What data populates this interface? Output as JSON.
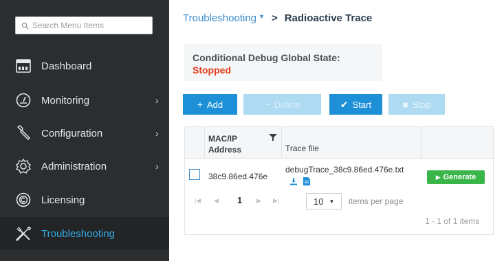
{
  "sidebar": {
    "search_placeholder": "Search Menu Items",
    "items": [
      {
        "label": "Dashboard",
        "icon": "dashboard-icon",
        "has_submenu": false
      },
      {
        "label": "Monitoring",
        "icon": "monitoring-gauge-icon",
        "has_submenu": true
      },
      {
        "label": "Configuration",
        "icon": "wrench-icon",
        "has_submenu": true
      },
      {
        "label": "Administration",
        "icon": "gear-icon",
        "has_submenu": true
      },
      {
        "label": "Licensing",
        "icon": "licensing-icon",
        "has_submenu": false
      },
      {
        "label": "Troubleshooting",
        "icon": "tools-icon",
        "has_submenu": false,
        "active": true
      }
    ],
    "chevron": "›"
  },
  "breadcrumb": {
    "parent": "Troubleshooting",
    "separator": ">",
    "current": "Radioactive Trace"
  },
  "state": {
    "label": "Conditional Debug Global State:",
    "value": "Stopped"
  },
  "toolbar": {
    "add_label": "Add",
    "delete_label": "Delete",
    "start_label": "Start",
    "stop_label": "Stop"
  },
  "table": {
    "columns": [
      "MAC/IP Address",
      "Trace file"
    ],
    "rows": [
      {
        "mac": "38c9.86ed.476e",
        "trace_file": "debugTrace_38c9.86ed.476e.txt",
        "action": "Generate"
      }
    ]
  },
  "pager": {
    "page": "1",
    "page_size": "10",
    "per_page_label": "items per page",
    "range": "1 - 1 of 1 items"
  },
  "colors": {
    "accent": "#1e90d8",
    "sidebar_bg": "#2b2d2f",
    "stopped": "#e23b1c",
    "generate": "#3ab54a",
    "active_nav": "#35a7e0"
  }
}
